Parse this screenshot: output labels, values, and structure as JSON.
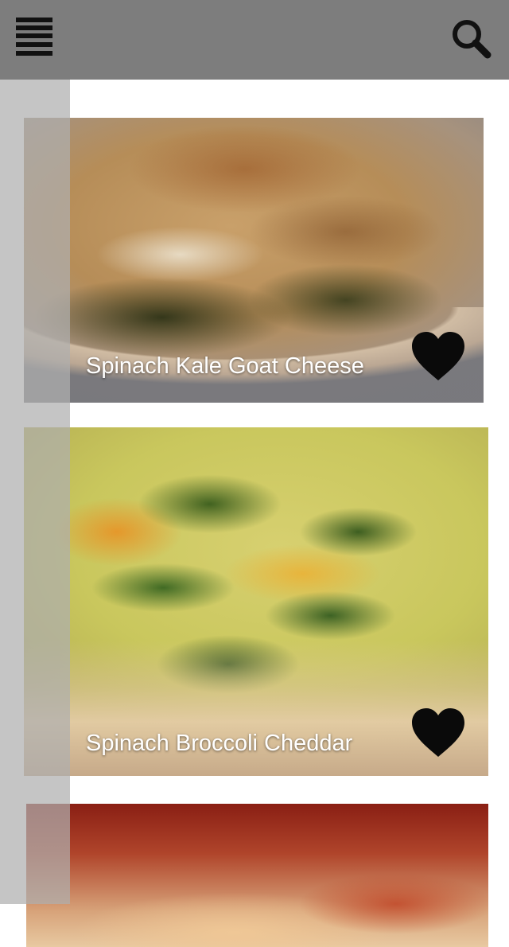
{
  "header": {
    "menu_icon": "hamburger-menu-icon",
    "search_icon": "search-icon",
    "background_color": "#7d7d7d"
  },
  "recipes": [
    {
      "title": "Spinach Kale Goat Cheese",
      "favorite_icon": "heart-icon",
      "favorited": true
    },
    {
      "title": "Spinach Broccoli Cheddar",
      "favorite_icon": "heart-icon",
      "favorited": true
    },
    {
      "title": "",
      "favorite_icon": "heart-icon"
    }
  ]
}
